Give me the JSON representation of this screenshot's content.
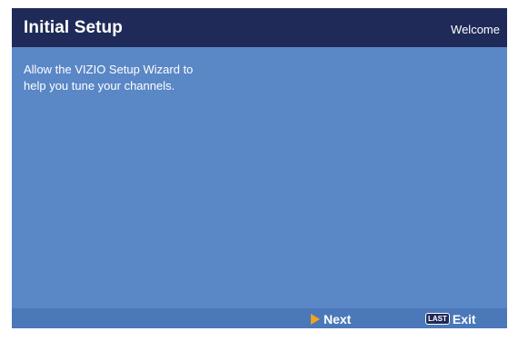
{
  "header": {
    "title": "Initial Setup",
    "page_label": "Welcome"
  },
  "body": {
    "message_line1": "Allow the VIZIO Setup Wizard to",
    "message_line2": "help you tune your channels."
  },
  "footer": {
    "next_label": "Next",
    "last_key_label": "LAST",
    "exit_label": "Exit"
  },
  "colors": {
    "header_bg": "#1f2a58",
    "panel_bg": "#5a87c6",
    "footer_bg": "#4a78b9",
    "next_arrow": "#f2a320"
  },
  "icons": {
    "next": "play-arrow-icon"
  }
}
